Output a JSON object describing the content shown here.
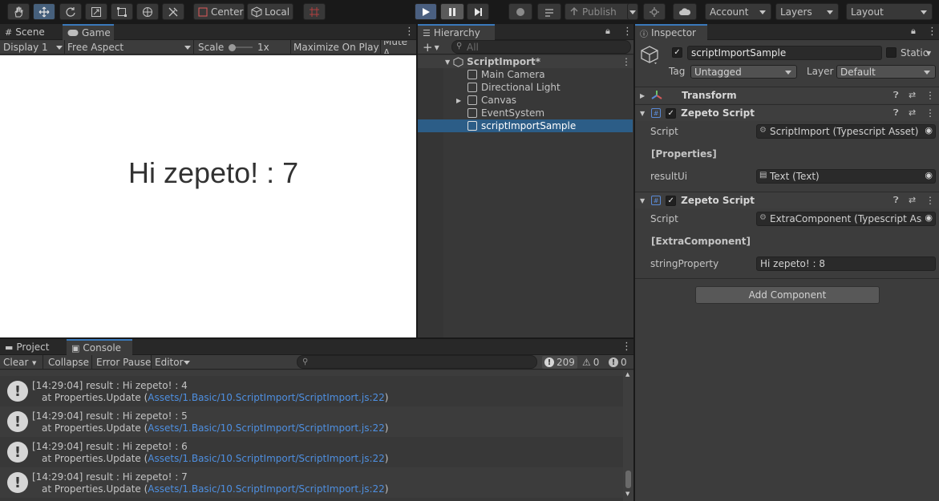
{
  "toolbar": {
    "tools": [
      "hand-icon",
      "move-icon",
      "rotate-icon",
      "scale-icon",
      "rect-icon",
      "transform-icon",
      "custom-tool-icon"
    ],
    "center_label": "Center",
    "local_label": "Local",
    "publish_label": "Publish",
    "account_label": "Account",
    "layers_label": "Layers",
    "layout_label": "Layout"
  },
  "game_panel": {
    "tab_scene": "Scene",
    "tab_game": "Game",
    "display": "Display 1",
    "aspect": "Free Aspect",
    "scale_label": "Scale",
    "scale_value": "1x",
    "maximize": "Maximize On Play",
    "mute": "Mute A",
    "game_text": "Hi zepeto! : 7"
  },
  "hierarchy": {
    "title": "Hierarchy",
    "search_placeholder": "All",
    "scene_name": "ScriptImport*",
    "items": [
      {
        "label": "Main Camera"
      },
      {
        "label": "Directional Light"
      },
      {
        "label": "Canvas"
      },
      {
        "label": "EventSystem"
      },
      {
        "label": "scriptImportSample"
      }
    ]
  },
  "inspector": {
    "title": "Inspector",
    "object_name": "scriptImportSample",
    "static_label": "Static",
    "tag_label": "Tag",
    "tag_value": "Untagged",
    "layer_label": "Layer",
    "layer_value": "Default",
    "transform_label": "Transform",
    "components": [
      {
        "title": "Zepeto Script",
        "script_label": "Script",
        "script_value": "ScriptImport (Typescript Asset)",
        "section": "[Properties]",
        "prop_label": "resultUi",
        "prop_value": "Text (Text)"
      },
      {
        "title": "Zepeto Script",
        "script_label": "Script",
        "script_value": "ExtraComponent (Typescript Asse",
        "section": "[ExtraComponent]",
        "prop_label": "stringProperty",
        "prop_value": "Hi zepeto! : 8"
      }
    ],
    "add_component": "Add Component"
  },
  "console": {
    "tab_project": "Project",
    "tab_console": "Console",
    "clear": "Clear",
    "collapse": "Collapse",
    "error_pause": "Error Pause",
    "editor": "Editor",
    "count_log": "209",
    "count_warn": "0",
    "count_error": "0",
    "entries": [
      {
        "msg": "[14:29:04] result : Hi zepeto! : 4",
        "trace": "at Properties.Update (",
        "link": "Assets/1.Basic/10.ScriptImport/ScriptImport.js:22",
        "tail": ")"
      },
      {
        "msg": "[14:29:04] result : Hi zepeto! : 5",
        "trace": "at Properties.Update (",
        "link": "Assets/1.Basic/10.ScriptImport/ScriptImport.js:22",
        "tail": ")"
      },
      {
        "msg": "[14:29:04] result : Hi zepeto! : 6",
        "trace": "at Properties.Update (",
        "link": "Assets/1.Basic/10.ScriptImport/ScriptImport.js:22",
        "tail": ")"
      },
      {
        "msg": "[14:29:04] result : Hi zepeto! : 7",
        "trace": "at Properties.Update (",
        "link": "Assets/1.Basic/10.ScriptImport/ScriptImport.js:22",
        "tail": ")"
      }
    ]
  },
  "colors": {
    "accent": "#3a79bb",
    "link": "#4e8fe0",
    "selection": "#2c5d87"
  }
}
